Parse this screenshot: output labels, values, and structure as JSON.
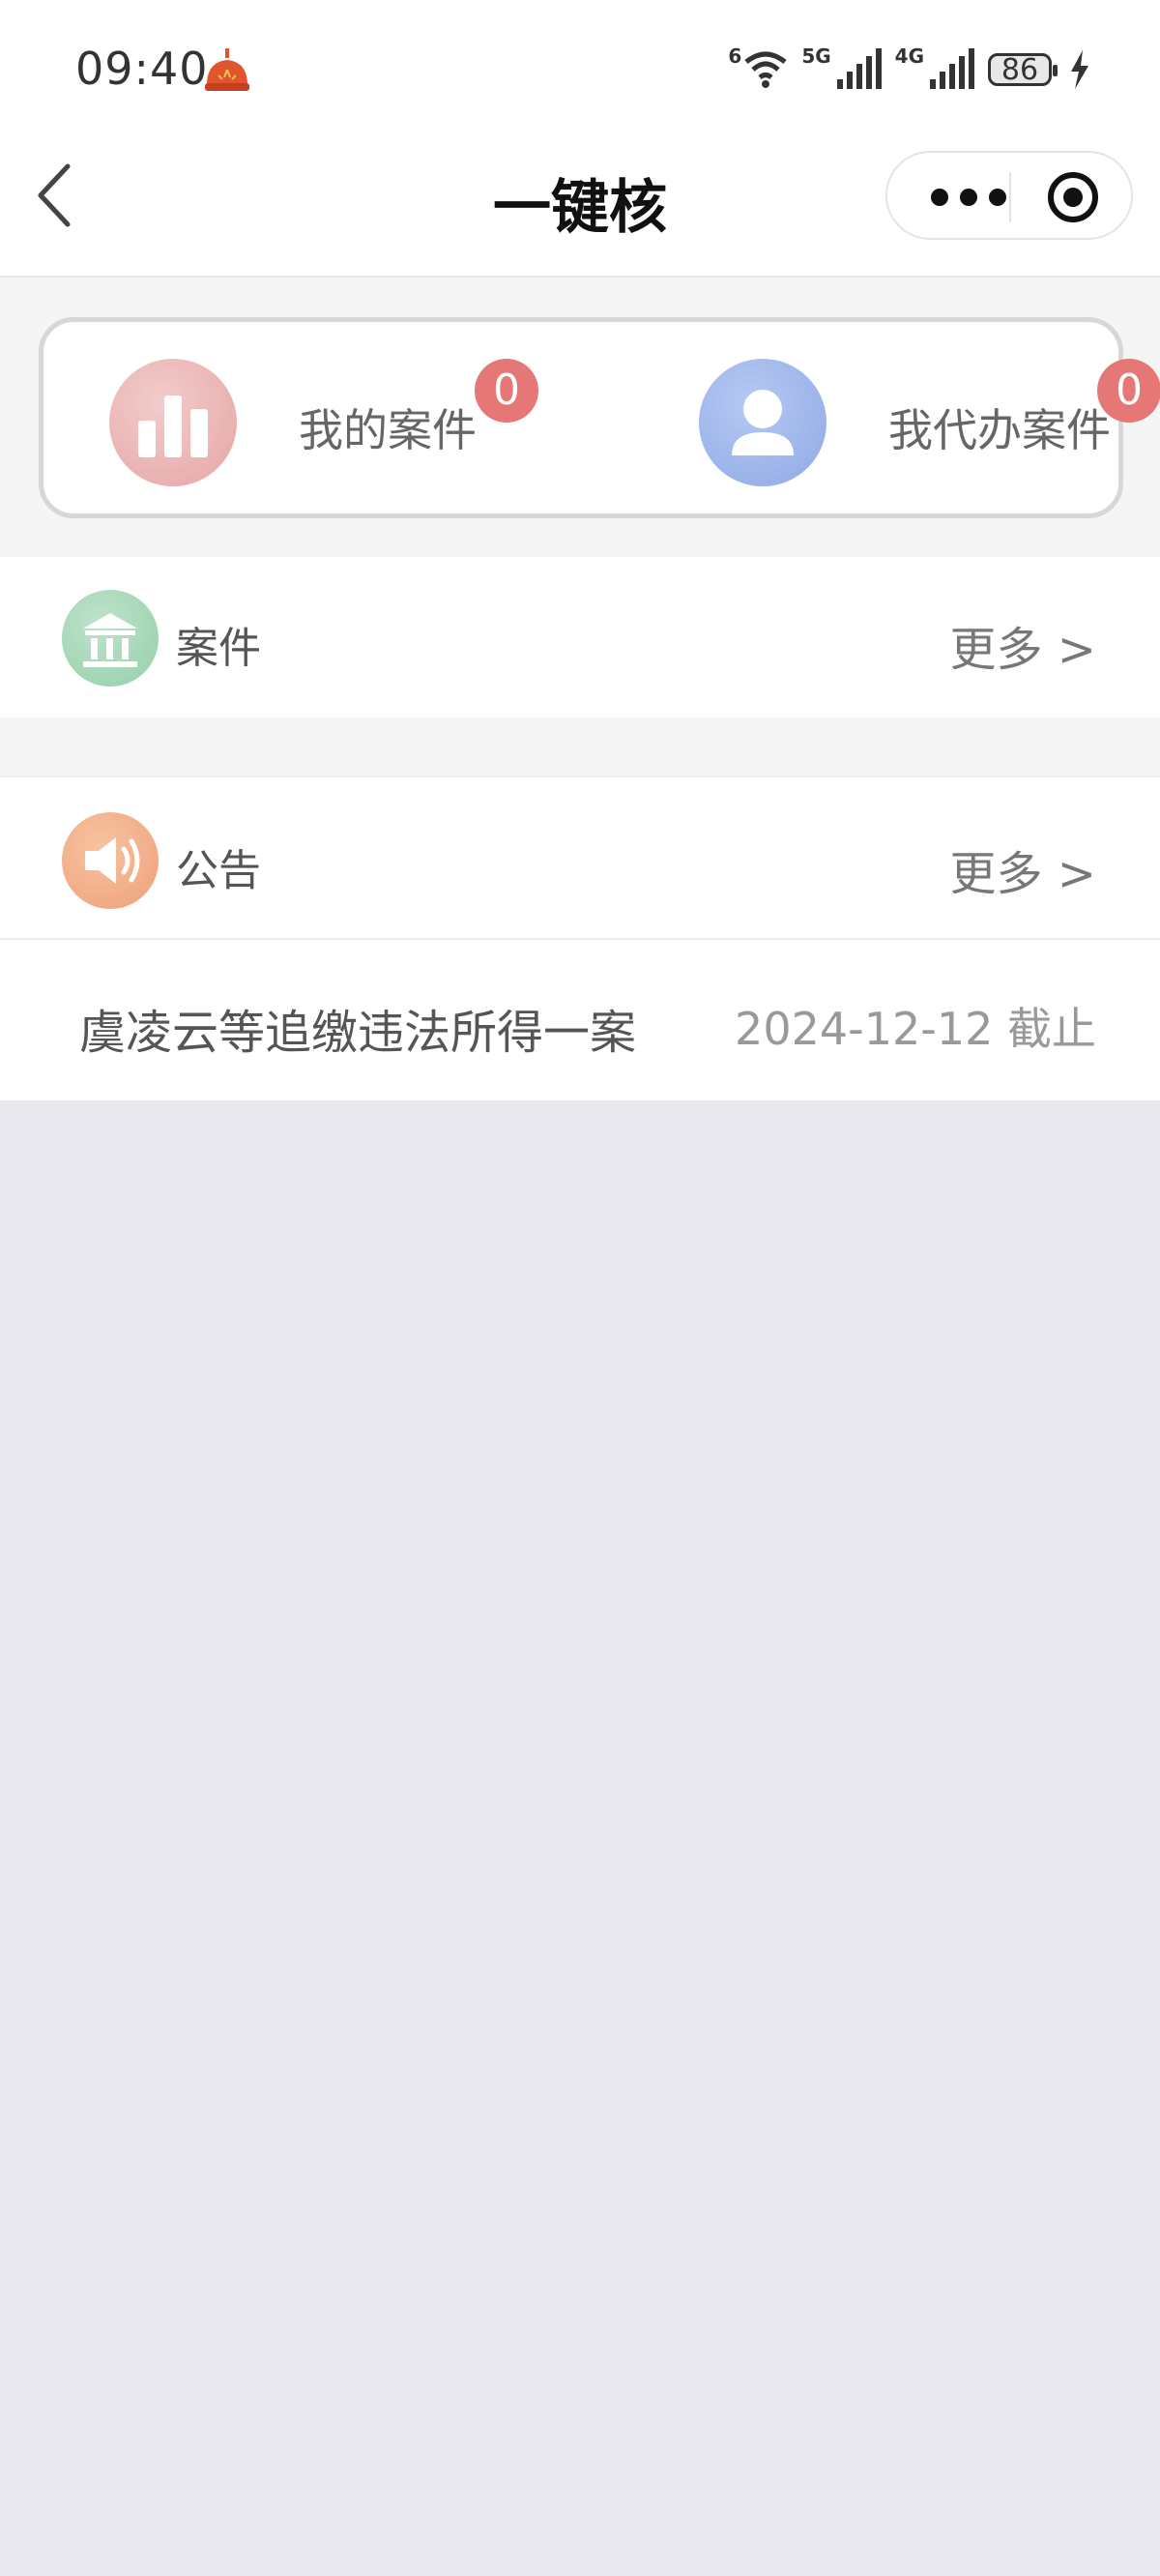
{
  "status_bar": {
    "time": "09:40",
    "wifi_label": "6",
    "sim1_label": "5G",
    "sim2_label": "4G",
    "battery": "86"
  },
  "nav": {
    "title": "一键核"
  },
  "stats": [
    {
      "label": "我的案件",
      "badge": "0",
      "icon": "bar-chart-icon"
    },
    {
      "label": "我代办案件",
      "badge": "0",
      "icon": "user-icon"
    }
  ],
  "cases_section": {
    "title": "案件",
    "more": "更多 >",
    "icon": "bank-icon"
  },
  "notice_section": {
    "title": "公告",
    "more": "更多 >",
    "icon": "speaker-icon",
    "items": [
      {
        "title": "虞凌云等追缴违法所得一案",
        "deadline": "2024-12-12 截止"
      }
    ]
  },
  "colors": {
    "badge": "#e57877",
    "page_bg": "#e9e8ee",
    "band_bg": "#f5f5f5"
  }
}
